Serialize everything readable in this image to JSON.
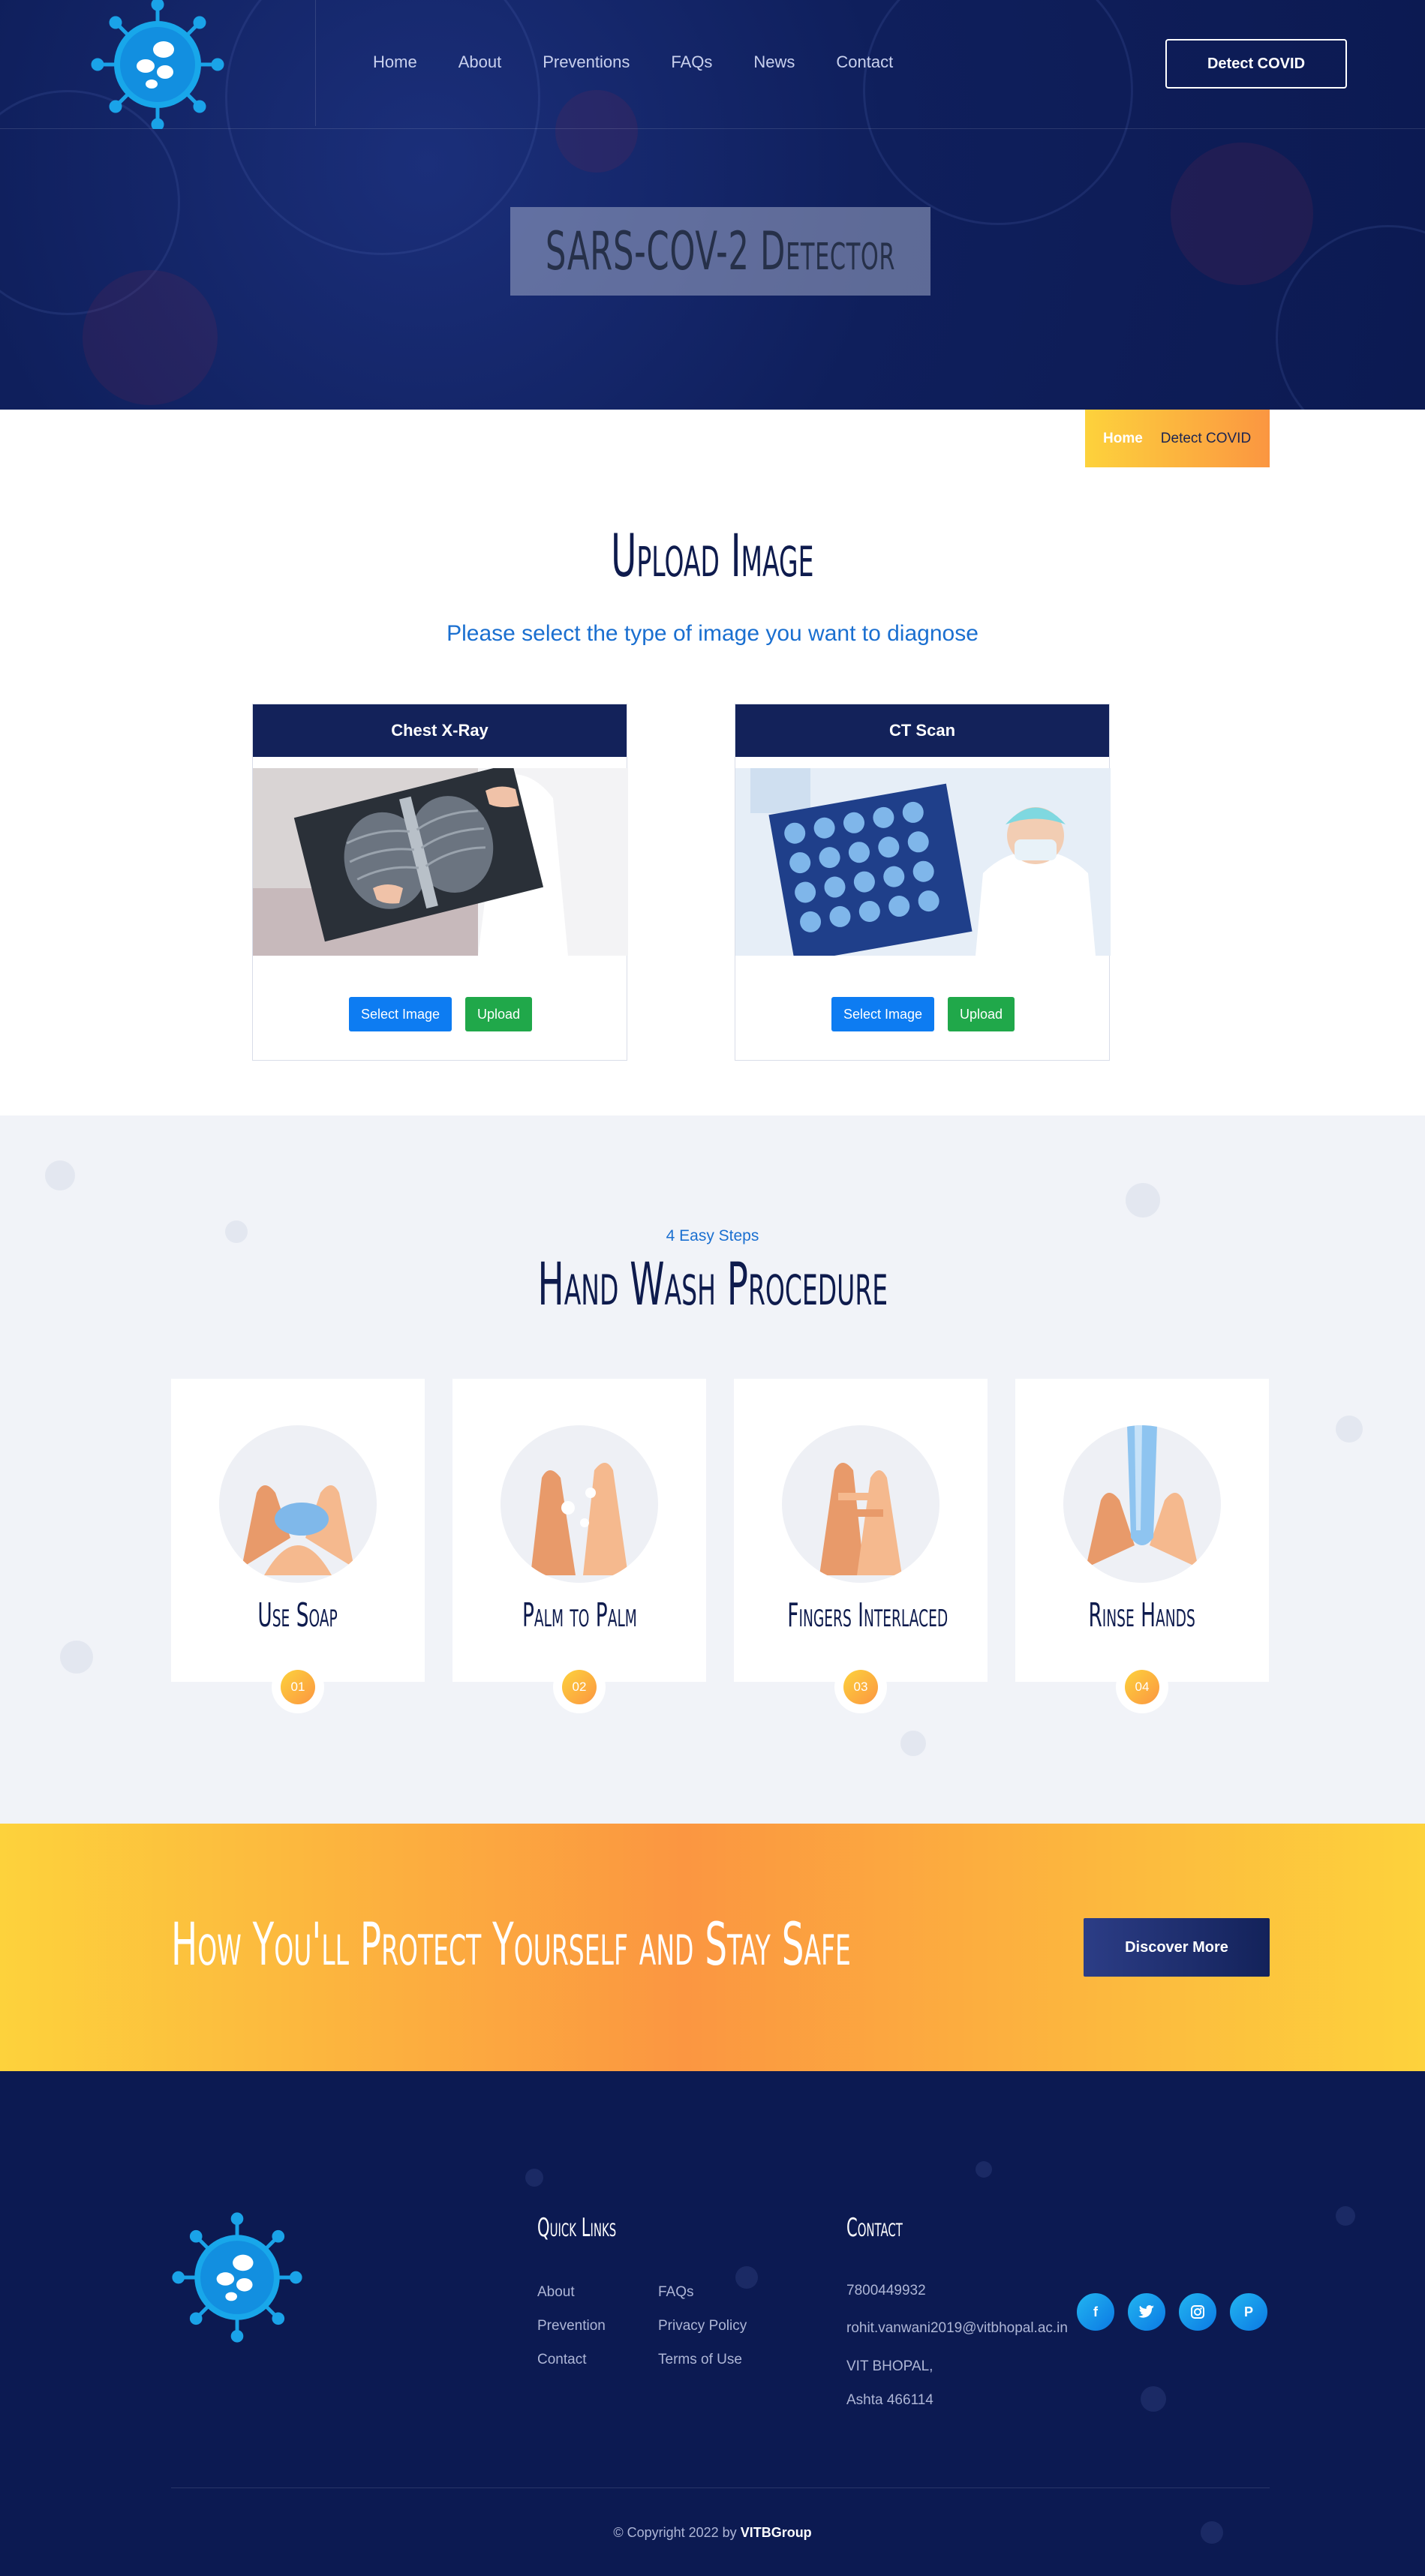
{
  "nav": {
    "items": [
      "Home",
      "About",
      "Preventions",
      "FAQs",
      "News",
      "Contact"
    ],
    "cta": "Detect COVID"
  },
  "hero": {
    "title": "SARS-COV-2 Detector"
  },
  "breadcrumb": {
    "home": "Home",
    "current": "Detect COVID"
  },
  "upload": {
    "title": "Upload Image",
    "subtitle": "Please select the type of image you want to diagnose",
    "cards": [
      {
        "title": "Chest X-Ray",
        "select_label": "Select Image",
        "upload_label": "Upload"
      },
      {
        "title": "CT Scan",
        "select_label": "Select Image",
        "upload_label": "Upload"
      }
    ]
  },
  "handwash": {
    "kicker": "4 Easy Steps",
    "title": "Hand Wash Procedure",
    "steps": [
      {
        "label": "Use Soap",
        "num": "01"
      },
      {
        "label": "Palm to Palm",
        "num": "02"
      },
      {
        "label": "Fingers Interlaced",
        "num": "03"
      },
      {
        "label": "Rinse Hands",
        "num": "04"
      }
    ]
  },
  "promo": {
    "title": "How You'll Protect Yourself and Stay Safe",
    "button": "Discover More"
  },
  "footer": {
    "quick_links_title": "Quick Links",
    "links_col1": [
      "About",
      "Prevention",
      "Contact"
    ],
    "links_col2": [
      "FAQs",
      "Privacy Policy",
      "Terms of Use"
    ],
    "contact_title": "Contact",
    "phone": "7800449932",
    "email": "rohit.vanwani2019@vitbhopal.ac.in",
    "address_line1": "VIT BHOPAL,",
    "address_line2": "Ashta 466114",
    "socials": [
      "facebook-icon",
      "twitter-icon",
      "instagram-icon",
      "pinterest-icon"
    ],
    "copyright_prefix": "© Copyright 2022 by",
    "copyright_org": "VITBGroup"
  },
  "colors": {
    "navy": "#0c1a52",
    "accent_yellow": "#fdd23c",
    "accent_orange": "#fb9641",
    "link_blue": "#1a6fd0",
    "button_blue": "#0d7cf2",
    "button_green": "#20a84a"
  }
}
